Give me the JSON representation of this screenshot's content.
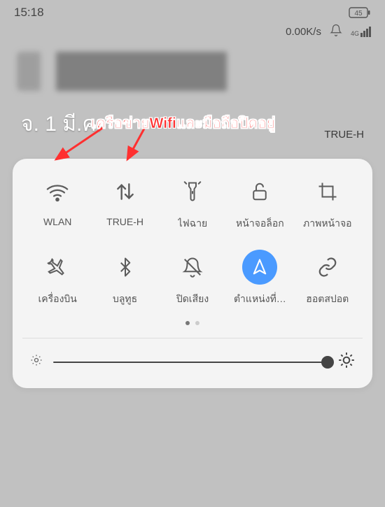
{
  "status": {
    "time": "15:18",
    "battery_pct": "45",
    "data_rate": "0.00K/s",
    "signal_label": "4G"
  },
  "header": {
    "date": "จ. 1 มี.ค.",
    "carrier": "TRUE-H"
  },
  "annotation": {
    "text": "เครือข่ายWifiและมือถือปิดอยู่"
  },
  "tiles": [
    {
      "id": "wlan",
      "label": "WLAN",
      "icon": "wifi",
      "active": false
    },
    {
      "id": "data",
      "label": "TRUE-H",
      "icon": "data-arrows",
      "active": false
    },
    {
      "id": "flashlight",
      "label": "ไฟฉาย",
      "icon": "flashlight",
      "active": false
    },
    {
      "id": "lockscreen",
      "label": "หน้าจอล็อก",
      "icon": "lock",
      "active": false
    },
    {
      "id": "screenshot",
      "label": "ภาพหน้าจอ",
      "icon": "crop",
      "active": false
    },
    {
      "id": "airplane",
      "label": "เครื่องบิน",
      "icon": "airplane",
      "active": false
    },
    {
      "id": "bluetooth",
      "label": "บลูทูธ",
      "icon": "bluetooth",
      "active": false
    },
    {
      "id": "mute",
      "label": "ปิดเสียง",
      "icon": "bell-off",
      "active": false
    },
    {
      "id": "location",
      "label": "ตำแหน่งที่…",
      "icon": "navigation",
      "active": true
    },
    {
      "id": "hotspot",
      "label": "ฮอตสปอต",
      "icon": "link",
      "active": false
    }
  ],
  "pager": {
    "count": 2,
    "active_index": 0
  },
  "brightness": {
    "value": 100
  },
  "colors": {
    "accent": "#4a9aff",
    "annotation": "#ff3030"
  }
}
